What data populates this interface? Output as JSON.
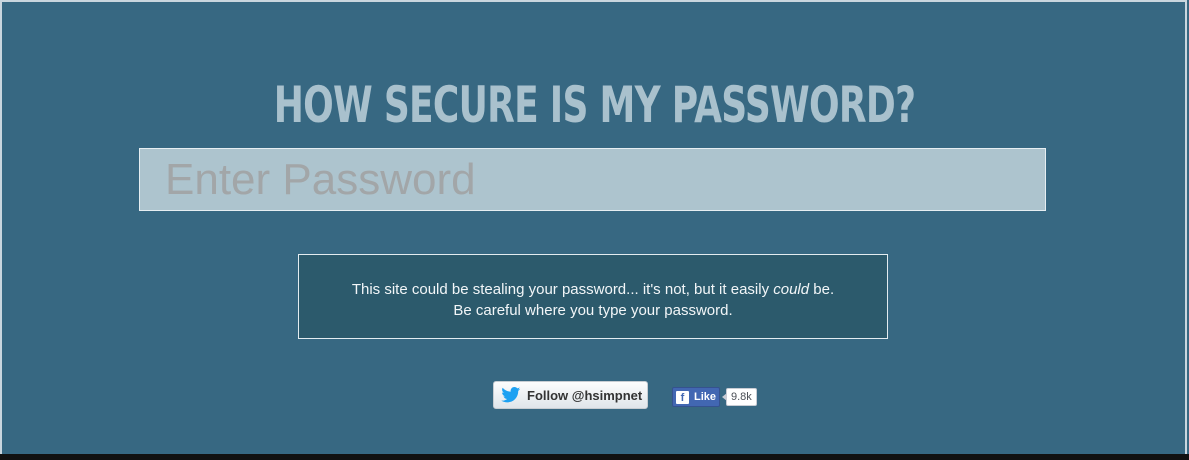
{
  "header": {
    "title": "HOW SECURE IS MY PASSWORD?"
  },
  "password_field": {
    "placeholder": "Enter Password",
    "value": ""
  },
  "notice": {
    "line1_before": "This site could be stealing your password... it's not, but it easily ",
    "line1_emphasis": "could",
    "line1_after": " be.",
    "line2": "Be careful where you type your password."
  },
  "social": {
    "twitter_label": "Follow @hsimpnet",
    "twitter_icon": "twitter-bird-icon",
    "facebook_label": "Like",
    "facebook_icon": "facebook-f-icon",
    "facebook_count": "9.8k"
  },
  "colors": {
    "background": "#376882",
    "title": "#a9c1cd",
    "input_bg": "#adc4ce",
    "notice_bg": "#2c5a6c",
    "twitter_blue": "#1da1f2",
    "facebook_blue": "#4267b2"
  }
}
